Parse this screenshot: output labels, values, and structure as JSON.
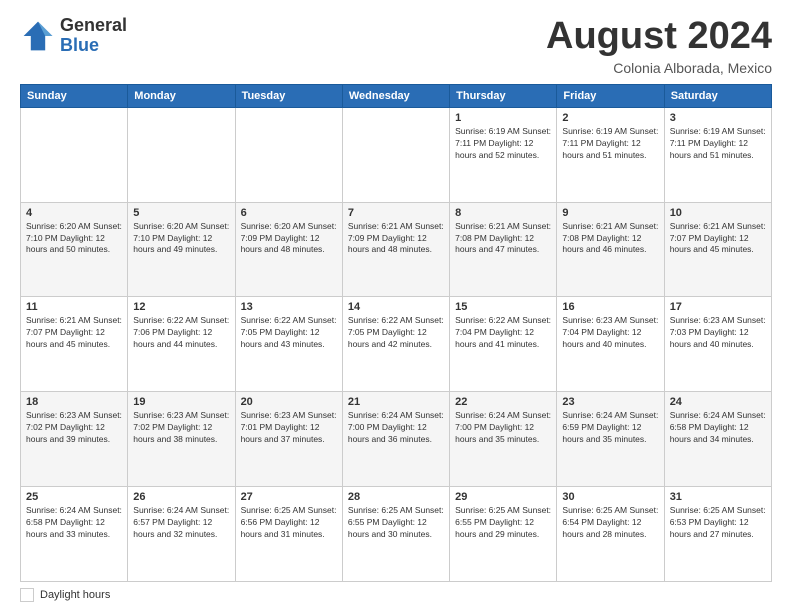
{
  "logo": {
    "general": "General",
    "blue": "Blue"
  },
  "title": {
    "month_year": "August 2024",
    "location": "Colonia Alborada, Mexico"
  },
  "weekdays": [
    "Sunday",
    "Monday",
    "Tuesday",
    "Wednesday",
    "Thursday",
    "Friday",
    "Saturday"
  ],
  "legend": {
    "label": "Daylight hours"
  },
  "weeks": [
    [
      {
        "day": "",
        "info": ""
      },
      {
        "day": "",
        "info": ""
      },
      {
        "day": "",
        "info": ""
      },
      {
        "day": "",
        "info": ""
      },
      {
        "day": "1",
        "info": "Sunrise: 6:19 AM\nSunset: 7:11 PM\nDaylight: 12 hours\nand 52 minutes."
      },
      {
        "day": "2",
        "info": "Sunrise: 6:19 AM\nSunset: 7:11 PM\nDaylight: 12 hours\nand 51 minutes."
      },
      {
        "day": "3",
        "info": "Sunrise: 6:19 AM\nSunset: 7:11 PM\nDaylight: 12 hours\nand 51 minutes."
      }
    ],
    [
      {
        "day": "4",
        "info": "Sunrise: 6:20 AM\nSunset: 7:10 PM\nDaylight: 12 hours\nand 50 minutes."
      },
      {
        "day": "5",
        "info": "Sunrise: 6:20 AM\nSunset: 7:10 PM\nDaylight: 12 hours\nand 49 minutes."
      },
      {
        "day": "6",
        "info": "Sunrise: 6:20 AM\nSunset: 7:09 PM\nDaylight: 12 hours\nand 48 minutes."
      },
      {
        "day": "7",
        "info": "Sunrise: 6:21 AM\nSunset: 7:09 PM\nDaylight: 12 hours\nand 48 minutes."
      },
      {
        "day": "8",
        "info": "Sunrise: 6:21 AM\nSunset: 7:08 PM\nDaylight: 12 hours\nand 47 minutes."
      },
      {
        "day": "9",
        "info": "Sunrise: 6:21 AM\nSunset: 7:08 PM\nDaylight: 12 hours\nand 46 minutes."
      },
      {
        "day": "10",
        "info": "Sunrise: 6:21 AM\nSunset: 7:07 PM\nDaylight: 12 hours\nand 45 minutes."
      }
    ],
    [
      {
        "day": "11",
        "info": "Sunrise: 6:21 AM\nSunset: 7:07 PM\nDaylight: 12 hours\nand 45 minutes."
      },
      {
        "day": "12",
        "info": "Sunrise: 6:22 AM\nSunset: 7:06 PM\nDaylight: 12 hours\nand 44 minutes."
      },
      {
        "day": "13",
        "info": "Sunrise: 6:22 AM\nSunset: 7:05 PM\nDaylight: 12 hours\nand 43 minutes."
      },
      {
        "day": "14",
        "info": "Sunrise: 6:22 AM\nSunset: 7:05 PM\nDaylight: 12 hours\nand 42 minutes."
      },
      {
        "day": "15",
        "info": "Sunrise: 6:22 AM\nSunset: 7:04 PM\nDaylight: 12 hours\nand 41 minutes."
      },
      {
        "day": "16",
        "info": "Sunrise: 6:23 AM\nSunset: 7:04 PM\nDaylight: 12 hours\nand 40 minutes."
      },
      {
        "day": "17",
        "info": "Sunrise: 6:23 AM\nSunset: 7:03 PM\nDaylight: 12 hours\nand 40 minutes."
      }
    ],
    [
      {
        "day": "18",
        "info": "Sunrise: 6:23 AM\nSunset: 7:02 PM\nDaylight: 12 hours\nand 39 minutes."
      },
      {
        "day": "19",
        "info": "Sunrise: 6:23 AM\nSunset: 7:02 PM\nDaylight: 12 hours\nand 38 minutes."
      },
      {
        "day": "20",
        "info": "Sunrise: 6:23 AM\nSunset: 7:01 PM\nDaylight: 12 hours\nand 37 minutes."
      },
      {
        "day": "21",
        "info": "Sunrise: 6:24 AM\nSunset: 7:00 PM\nDaylight: 12 hours\nand 36 minutes."
      },
      {
        "day": "22",
        "info": "Sunrise: 6:24 AM\nSunset: 7:00 PM\nDaylight: 12 hours\nand 35 minutes."
      },
      {
        "day": "23",
        "info": "Sunrise: 6:24 AM\nSunset: 6:59 PM\nDaylight: 12 hours\nand 35 minutes."
      },
      {
        "day": "24",
        "info": "Sunrise: 6:24 AM\nSunset: 6:58 PM\nDaylight: 12 hours\nand 34 minutes."
      }
    ],
    [
      {
        "day": "25",
        "info": "Sunrise: 6:24 AM\nSunset: 6:58 PM\nDaylight: 12 hours\nand 33 minutes."
      },
      {
        "day": "26",
        "info": "Sunrise: 6:24 AM\nSunset: 6:57 PM\nDaylight: 12 hours\nand 32 minutes."
      },
      {
        "day": "27",
        "info": "Sunrise: 6:25 AM\nSunset: 6:56 PM\nDaylight: 12 hours\nand 31 minutes."
      },
      {
        "day": "28",
        "info": "Sunrise: 6:25 AM\nSunset: 6:55 PM\nDaylight: 12 hours\nand 30 minutes."
      },
      {
        "day": "29",
        "info": "Sunrise: 6:25 AM\nSunset: 6:55 PM\nDaylight: 12 hours\nand 29 minutes."
      },
      {
        "day": "30",
        "info": "Sunrise: 6:25 AM\nSunset: 6:54 PM\nDaylight: 12 hours\nand 28 minutes."
      },
      {
        "day": "31",
        "info": "Sunrise: 6:25 AM\nSunset: 6:53 PM\nDaylight: 12 hours\nand 27 minutes."
      }
    ]
  ]
}
